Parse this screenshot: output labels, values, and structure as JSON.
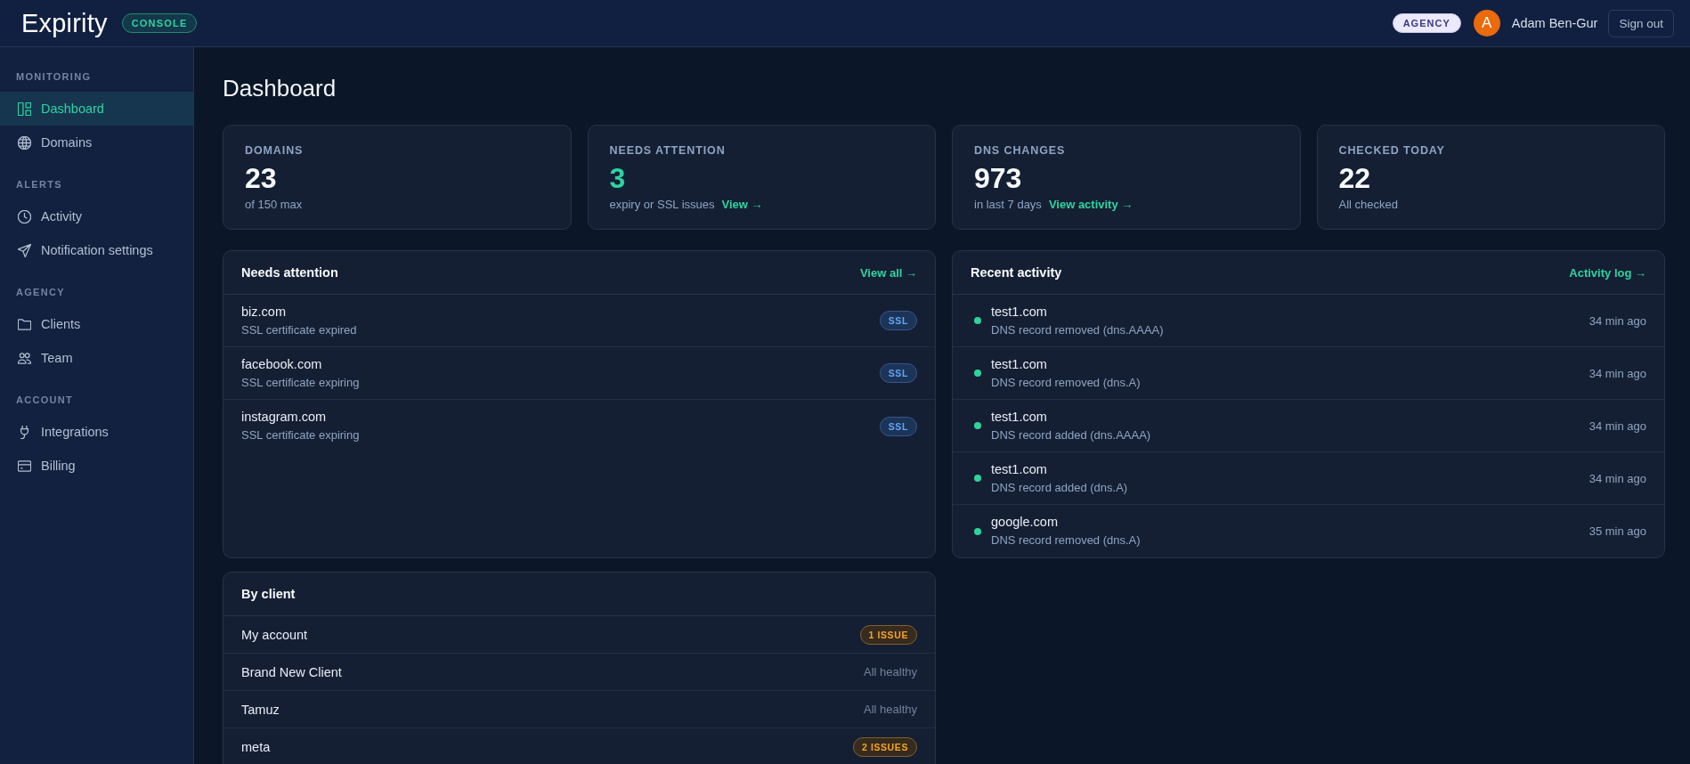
{
  "header": {
    "logo": "Expirity",
    "console_badge": "CONSOLE",
    "plan_badge": "AGENCY",
    "avatar_initial": "A",
    "user_name": "Adam Ben-Gur",
    "sign_out": "Sign out"
  },
  "sidebar": {
    "sections": [
      {
        "title": "MONITORING",
        "items": [
          {
            "label": "Dashboard",
            "selected": true
          },
          {
            "label": "Domains",
            "selected": false
          }
        ]
      },
      {
        "title": "ALERTS",
        "items": [
          {
            "label": "Activity",
            "selected": false
          },
          {
            "label": "Notification settings",
            "selected": false
          }
        ]
      },
      {
        "title": "AGENCY",
        "items": [
          {
            "label": "Clients",
            "selected": false
          },
          {
            "label": "Team",
            "selected": false
          }
        ]
      },
      {
        "title": "ACCOUNT",
        "items": [
          {
            "label": "Integrations",
            "selected": false
          },
          {
            "label": "Billing",
            "selected": false
          }
        ]
      }
    ]
  },
  "page_title": "Dashboard",
  "stats": [
    {
      "label": "DOMAINS",
      "value": "23",
      "note": "of 150 max",
      "highlighted": false
    },
    {
      "label": "NEEDS ATTENTION",
      "value": "3",
      "note": "expiry or SSL issues",
      "link": "View →",
      "highlighted": true
    },
    {
      "label": "DNS CHANGES",
      "value": "973",
      "note": "in last 7 days",
      "link": "View activity →",
      "highlighted": false
    },
    {
      "label": "CHECKED TODAY",
      "value": "22",
      "note": "All checked",
      "highlighted": false
    }
  ],
  "needs_attention": {
    "title": "Needs attention",
    "link": "View all →",
    "rows": [
      {
        "domain": "biz.com",
        "detail": "SSL certificate expired",
        "tag": "SSL"
      },
      {
        "domain": "facebook.com",
        "detail": "SSL certificate expiring",
        "tag": "SSL"
      },
      {
        "domain": "instagram.com",
        "detail": "SSL certificate expiring",
        "tag": "SSL"
      }
    ]
  },
  "recent_activity": {
    "title": "Recent activity",
    "link": "Activity log →",
    "rows": [
      {
        "domain": "test1.com",
        "detail": "DNS record removed (dns.AAAA)",
        "time": "34 min ago"
      },
      {
        "domain": "test1.com",
        "detail": "DNS record removed (dns.A)",
        "time": "34 min ago"
      },
      {
        "domain": "test1.com",
        "detail": "DNS record added (dns.AAAA)",
        "time": "34 min ago"
      },
      {
        "domain": "test1.com",
        "detail": "DNS record added (dns.A)",
        "time": "34 min ago"
      },
      {
        "domain": "google.com",
        "detail": "DNS record removed (dns.A)",
        "time": "35 min ago"
      }
    ]
  },
  "by_client": {
    "title": "By client",
    "rows": [
      {
        "name": "My account",
        "kind": "issues",
        "status": "1 ISSUE"
      },
      {
        "name": "Brand New Client",
        "kind": "healthy",
        "status": "All healthy"
      },
      {
        "name": "Tamuz",
        "kind": "healthy",
        "status": "All healthy"
      },
      {
        "name": "meta",
        "kind": "issues",
        "status": "2 ISSUES"
      }
    ]
  }
}
